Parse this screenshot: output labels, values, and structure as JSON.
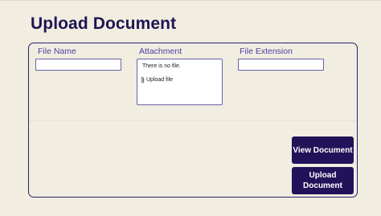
{
  "page": {
    "title": "Upload Document"
  },
  "form": {
    "file_name": {
      "label": "File Name",
      "value": ""
    },
    "attachment": {
      "label": "Attachment",
      "empty_text": "There is no file.",
      "upload_label": "Upload file",
      "icon": "paperclip-icon"
    },
    "file_extension": {
      "label": "File Extension",
      "value": ""
    }
  },
  "actions": {
    "view_document": "View Document",
    "upload_document": "Upload Document"
  },
  "colors": {
    "background": "#f1ede0",
    "accent": "#22125a",
    "label": "#4b3fa0",
    "border": "#2a2070"
  }
}
